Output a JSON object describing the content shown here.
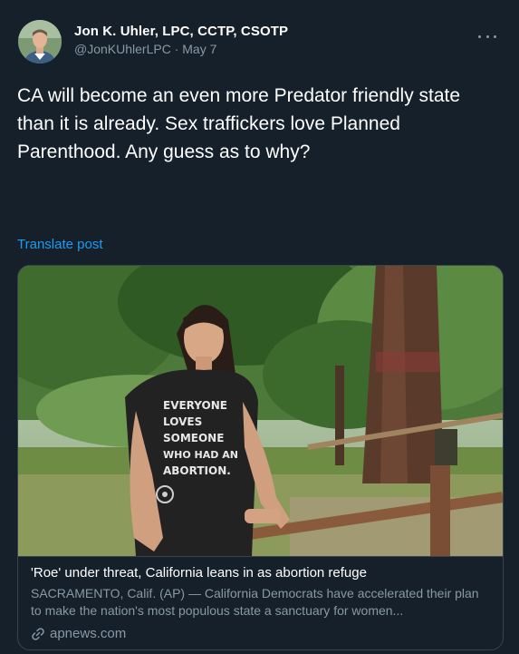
{
  "colors": {
    "background": "#15202b",
    "text_primary": "#ffffff",
    "text_secondary": "#8899a6",
    "link": "#1d9bf0",
    "border": "#38444d"
  },
  "tweet": {
    "author_name": "Jon K. Uhler, LPC, CCTP, CSOTP",
    "handle": "@JonKUhlerLPC",
    "separator": "·",
    "date": "May 7",
    "more_icon": "more-horizontal-icon",
    "avatar_icon": "avatar-photo",
    "text": "CA will become an even more Predator friendly state than it is already. Sex traffickers love Planned Parenthood. Any guess as to why?",
    "translate_label": "Translate post"
  },
  "card": {
    "image_shirt_lines": [
      "EVERYONE",
      "LOVES",
      "SOMEONE",
      "WHO HAD AN",
      "ABORTION."
    ],
    "title": "'Roe' under threat, California leans in as abortion refuge",
    "description": "SACRAMENTO, Calif. (AP) — California Democrats have accelerated their plan to make the nation's most populous state a sanctuary for women...",
    "domain": "apnews.com",
    "link_icon": "link-icon"
  }
}
